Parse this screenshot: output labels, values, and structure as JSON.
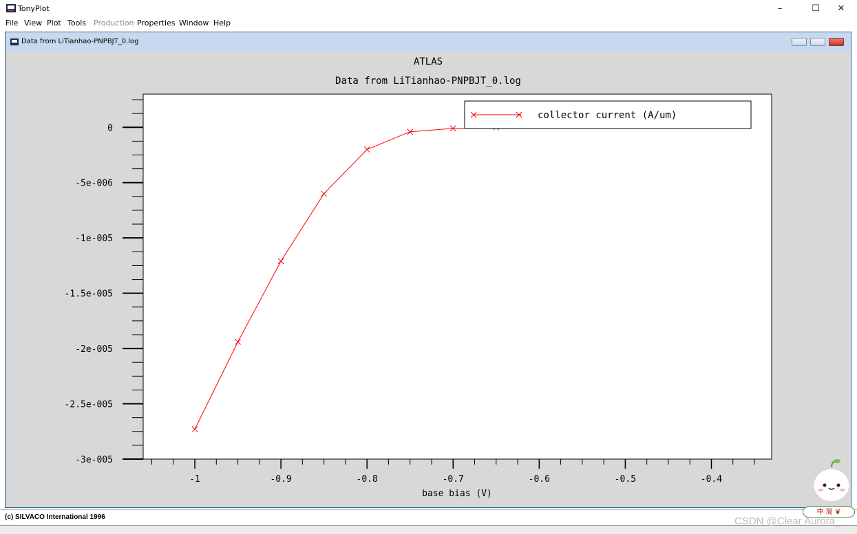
{
  "window": {
    "app_title": "TonyPlot",
    "controls": {
      "minimize": "–",
      "maximize": "☐",
      "close": "✕"
    }
  },
  "menubar": {
    "items": [
      {
        "label": "File",
        "enabled": true
      },
      {
        "label": "View",
        "enabled": true
      },
      {
        "label": "Plot",
        "enabled": true
      },
      {
        "label": "Tools",
        "enabled": true
      },
      {
        "label": "Production",
        "enabled": false
      },
      {
        "label": "Properties",
        "enabled": true
      },
      {
        "label": "Window",
        "enabled": true
      },
      {
        "label": "Help",
        "enabled": true
      }
    ]
  },
  "child_window": {
    "title": "Data from LiTianhao-PNPBJT_0.log"
  },
  "chart_data": {
    "type": "line",
    "title": "ATLAS",
    "subtitle": "Data from LiTianhao-PNPBJT_0.log",
    "xlabel": "base bias (V)",
    "ylabel": "",
    "xlim": [
      -1.06,
      -0.33
    ],
    "ylim": [
      -3e-05,
      3e-06
    ],
    "x_ticks": [
      -1,
      -0.9,
      -0.8,
      -0.7,
      -0.6,
      -0.5,
      -0.4
    ],
    "x_tick_labels": [
      "-1",
      "-0.9",
      "-0.8",
      "-0.7",
      "-0.6",
      "-0.5",
      "-0.4"
    ],
    "y_ticks": [
      0,
      -5e-06,
      -1e-05,
      -1.5e-05,
      -2e-05,
      -2.5e-05,
      -3e-05
    ],
    "y_tick_labels": [
      "0",
      "-5e-006",
      "-1e-005",
      "-1.5e-005",
      "-2e-005",
      "-2.5e-005",
      "-3e-005"
    ],
    "grid": false,
    "legend_position": "top-right",
    "series": [
      {
        "name": "collector current (A/um)",
        "color": "#ff0000",
        "marker": "x",
        "x": [
          -1.0,
          -0.95,
          -0.9,
          -0.85,
          -0.8,
          -0.75,
          -0.7,
          -0.65
        ],
        "y": [
          -2.73e-05,
          -1.94e-05,
          -1.21e-05,
          -6e-06,
          -2e-06,
          -4e-07,
          -1e-07,
          -1e-08
        ]
      }
    ]
  },
  "statusbar": {
    "text": "(c) SILVACO International 1996"
  },
  "overlay": {
    "watermark": "CSDN @Clear Aurora_",
    "ime_badge": "中 简 ❦"
  },
  "colors": {
    "plot_background": "#d8d8d8",
    "series": "#ff0000",
    "child_titlebar": "#c7d8ef"
  }
}
